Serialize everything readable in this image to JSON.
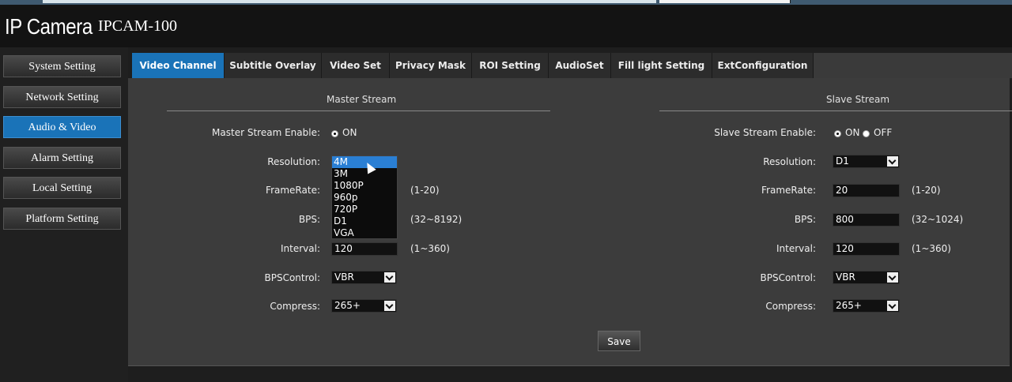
{
  "header": {
    "brand": "IP Camera",
    "model": "IPCAM-100"
  },
  "sidebar": {
    "items": [
      {
        "label": "System Setting"
      },
      {
        "label": "Network Setting"
      },
      {
        "label": "Audio & Video",
        "active": true
      },
      {
        "label": "Alarm Setting"
      },
      {
        "label": "Local Setting"
      },
      {
        "label": "Platform Setting"
      }
    ]
  },
  "tabs": [
    {
      "label": "Video Channel",
      "active": true
    },
    {
      "label": "Subtitle Overlay"
    },
    {
      "label": "Video Set"
    },
    {
      "label": "Privacy Mask"
    },
    {
      "label": "ROI Setting"
    },
    {
      "label": "AudioSet"
    },
    {
      "label": "Fill light Setting"
    },
    {
      "label": "ExtConfiguration"
    }
  ],
  "master": {
    "title": "Master Stream",
    "enable_label": "Master Stream Enable:",
    "on_label": "ON",
    "resolution_label": "Resolution:",
    "resolution_options": [
      "4M",
      "3M",
      "1080P",
      "960p",
      "720P",
      "D1",
      "VGA"
    ],
    "resolution_highlighted": "4M",
    "framerate_label": "FrameRate:",
    "framerate_range": "(1-20)",
    "bps_label": "BPS:",
    "bps_range": "(32~8192)",
    "interval_label": "Interval:",
    "interval_value": "120",
    "interval_range": "(1~360)",
    "bpscontrol_label": "BPSControl:",
    "bpscontrol_value": "VBR",
    "compress_label": "Compress:",
    "compress_value": "265+"
  },
  "slave": {
    "title": "Slave Stream",
    "enable_label": "Slave Stream Enable:",
    "on_label": "ON",
    "off_label": "OFF",
    "resolution_label": "Resolution:",
    "resolution_value": "D1",
    "framerate_label": "FrameRate:",
    "framerate_value": "20",
    "framerate_range": "(1-20)",
    "bps_label": "BPS:",
    "bps_value": "800",
    "bps_range": "(32~1024)",
    "interval_label": "Interval:",
    "interval_value": "120",
    "interval_range": "(1~360)",
    "bpscontrol_label": "BPSControl:",
    "bpscontrol_value": "VBR",
    "compress_label": "Compress:",
    "compress_value": "265+"
  },
  "save_label": "Save"
}
